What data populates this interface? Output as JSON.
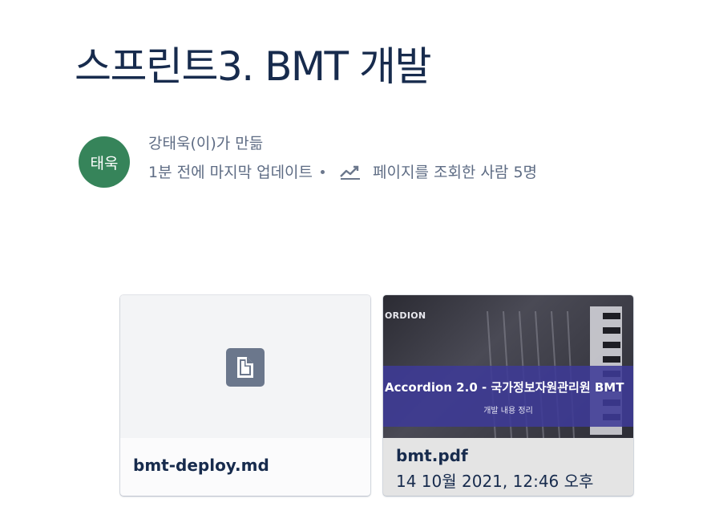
{
  "page": {
    "title": "스프린트3. BMT 개발"
  },
  "byline": {
    "avatar_initials": "태욱",
    "avatar_color": "#36845a",
    "created_by": "강태욱(이)가 만듦",
    "last_updated": "1분 전에 마지막 업데이트",
    "views_icon": "trend-chart-icon",
    "views_text": "페이지를 조회한 사람 5명"
  },
  "attachments": [
    {
      "name": "bmt-deploy.md",
      "icon": "document-icon"
    },
    {
      "name": "bmt.pdf",
      "date": "14 10월 2021, 12:46 오후",
      "thumbnail": {
        "brand": "ORDION",
        "title": "Accordion 2.0 - 국가정보자원관리원 BMT",
        "subtitle": "개발 내용 정리"
      }
    }
  ]
}
